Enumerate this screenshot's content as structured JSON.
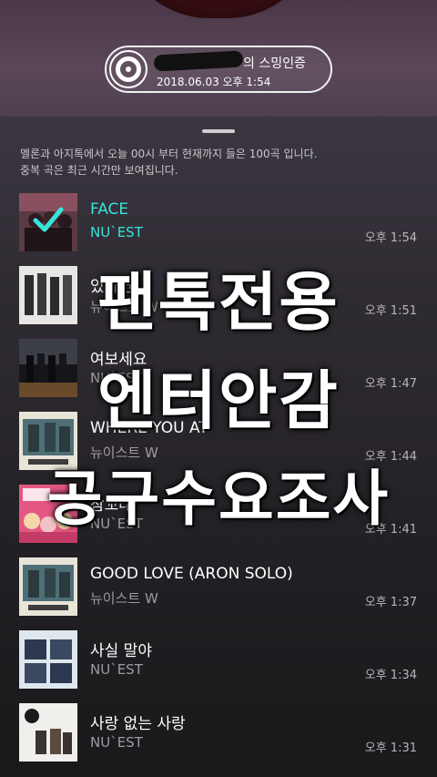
{
  "header": {
    "badge_title": "의 스밍인증",
    "badge_date": "2018.06.03 오후 1:54",
    "disc_icon": "vinyl-disc-icon"
  },
  "notice": {
    "line1": "멜론과 아지톡에서 오늘 00시 부터 현재까지 들은 100곡 입니다.",
    "line2": "중복 곡은 최근 시간만 보여집니다."
  },
  "songs": [
    {
      "title": "FACE",
      "artist": "NU`EST",
      "time": "오후 1:54"
    },
    {
      "title": "있다면",
      "artist": "뉴이스트 W",
      "time": "오후 1:51"
    },
    {
      "title": "여보세요",
      "artist": "NU`EST",
      "time": "오후 1:47"
    },
    {
      "title": "WHERE YOU AT",
      "artist": "뉴이스트 W",
      "time": "오후 1:44"
    },
    {
      "title": "잠꼬대",
      "artist": "NU`EST",
      "time": "오후 1:41"
    },
    {
      "title": "GOOD LOVE (ARON SOLO)",
      "artist": "뉴이스트 W",
      "time": "오후 1:37"
    },
    {
      "title": "사실 말야",
      "artist": "NU`EST",
      "time": "오후 1:34"
    },
    {
      "title": "사랑 없는 사랑",
      "artist": "NU`EST",
      "time": "오후 1:31"
    }
  ],
  "overlay": {
    "line1": "팬톡전용",
    "line2": "엔터안감",
    "line3": "공구수요조사"
  },
  "colors": {
    "accent": "#37e4d8",
    "background": "#1c1a1e"
  }
}
